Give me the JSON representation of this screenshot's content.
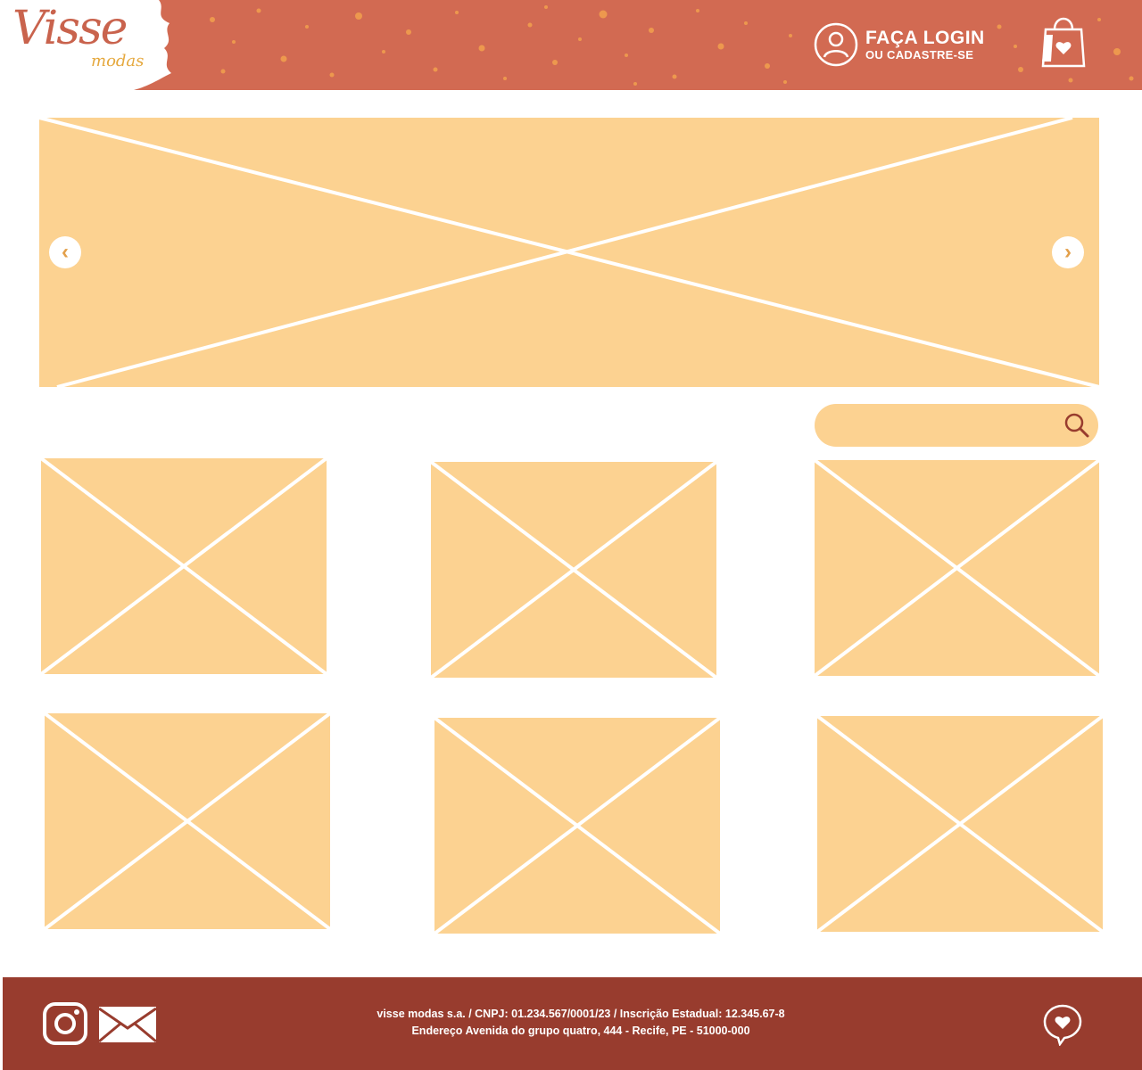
{
  "header": {
    "logo": {
      "main": "Visse",
      "sub": "modas"
    },
    "login": {
      "title": "FAÇA LOGIN",
      "subtitle": "OU CADASTRE-SE"
    },
    "icons": {
      "user": "user-circle-icon",
      "bag": "shopping-bag-heart-icon"
    }
  },
  "banner": {
    "prev_arrow": "‹",
    "next_arrow": "›"
  },
  "search": {
    "value": "",
    "placeholder": "",
    "icon": "search-icon"
  },
  "products": [
    {
      "name": "product-image-1"
    },
    {
      "name": "product-image-2"
    },
    {
      "name": "product-image-3"
    },
    {
      "name": "product-image-4"
    },
    {
      "name": "product-image-5"
    },
    {
      "name": "product-image-6"
    }
  ],
  "footer": {
    "line1": "visse modas s.a. / CNPJ: 01.234.567/0001/23 / Inscrição Estadual: 12.345.67-8",
    "line2": "Endereço Avenida do grupo quatro, 444 - Recife, PE - 51000-000",
    "icons": [
      "instagram-icon",
      "mail-icon",
      "heart-chat-icon"
    ]
  },
  "colors": {
    "header_bg": "#d26a52",
    "placeholder_fill": "#fcd291",
    "footer_bg": "#983c2e",
    "accent_gold": "#e5a83d",
    "white": "#ffffff"
  }
}
